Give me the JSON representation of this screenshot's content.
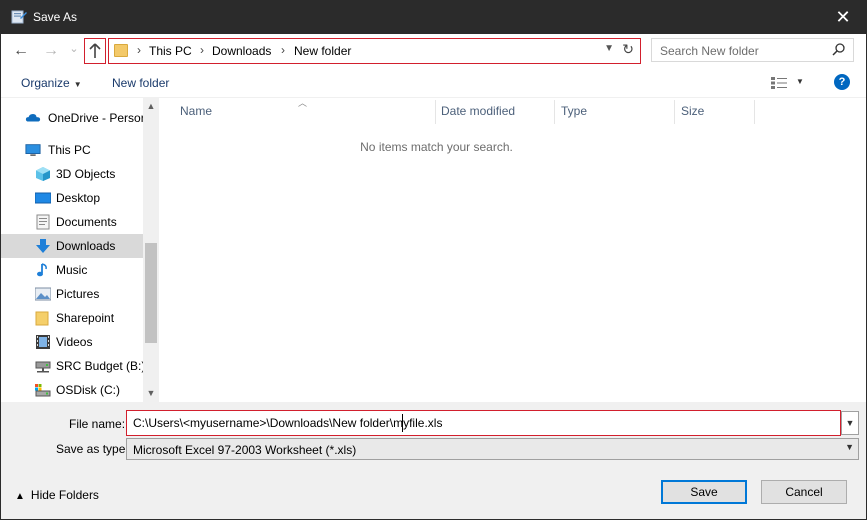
{
  "window": {
    "title": "Save As",
    "close_glyph": "✕"
  },
  "nav": {
    "back_glyph": "←",
    "forward_glyph": "→",
    "recent_glyph": "⌄",
    "breadcrumbs": [
      "This PC",
      "Downloads",
      "New folder"
    ],
    "separator": "›",
    "search_placeholder": "Search New folder"
  },
  "commands": {
    "organize": "Organize",
    "new_folder": "New folder"
  },
  "sidebar": {
    "items": [
      {
        "label": "OneDrive - Persor",
        "icon": "onedrive-icon"
      },
      {
        "label": "This PC",
        "icon": "computer-icon"
      },
      {
        "label": "3D Objects",
        "icon": "3d-objects-icon"
      },
      {
        "label": "Desktop",
        "icon": "desktop-icon"
      },
      {
        "label": "Documents",
        "icon": "documents-icon"
      },
      {
        "label": "Downloads",
        "icon": "downloads-icon",
        "selected": true
      },
      {
        "label": "Music",
        "icon": "music-icon"
      },
      {
        "label": "Pictures",
        "icon": "pictures-icon"
      },
      {
        "label": "Sharepoint",
        "icon": "folder-icon"
      },
      {
        "label": "Videos",
        "icon": "videos-icon"
      },
      {
        "label": "SRC Budget (B:)",
        "icon": "network-drive-icon"
      },
      {
        "label": "OSDisk (C:)",
        "icon": "disk-icon"
      }
    ]
  },
  "columns": [
    "Name",
    "Date modified",
    "Type",
    "Size"
  ],
  "empty_message": "No items match your search.",
  "form": {
    "filename_label": "File name:",
    "filename_value": "C:\\Users\\<myusername>\\Downloads\\New folder\\myfile.xls",
    "savetype_label": "Save as type:",
    "savetype_value": "Microsoft Excel 97-2003 Worksheet (*.xls)"
  },
  "footer": {
    "hide_folders": "Hide Folders",
    "save": "Save",
    "cancel": "Cancel"
  },
  "colors": {
    "highlight_box": "#d21f2d",
    "accent": "#0078d7",
    "titlebar": "#2b2b2b"
  }
}
